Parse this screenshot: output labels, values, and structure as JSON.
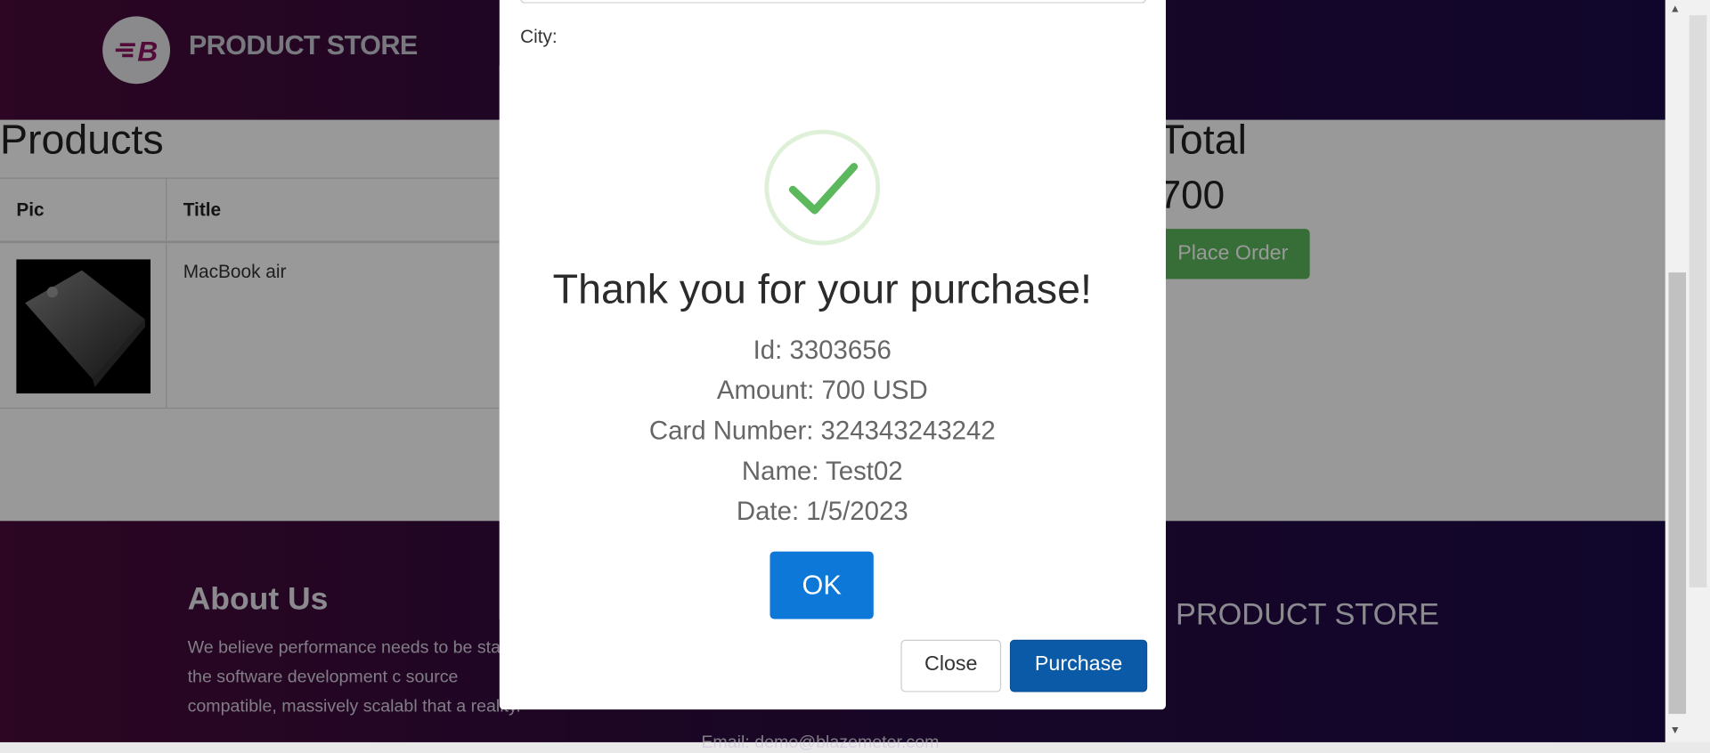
{
  "header": {
    "brand": "PRODUCT STORE"
  },
  "cart": {
    "products_title": "Products",
    "columns": {
      "pic": "Pic",
      "title": "Title"
    },
    "rows": [
      {
        "title": "MacBook air"
      }
    ],
    "total_title": "Total",
    "total_value": "700",
    "place_order": "Place Order"
  },
  "footer": {
    "about_title": "About Us",
    "about_text": "We believe performance needs to be stage of the software development c source compatible, massively scalabl that a reality.",
    "brand": "PRODUCT STORE",
    "email": "Email: demo@blazemeter.com"
  },
  "order_modal": {
    "city_label": "City:",
    "close": "Close",
    "purchase": "Purchase"
  },
  "alert": {
    "title": "Thank you for your purchase!",
    "id_line": "Id: 3303656",
    "amount_line": "Amount: 700 USD",
    "card_line": "Card Number: 324343243242",
    "name_line": "Name: Test02",
    "date_line": "Date: 1/5/2023",
    "ok": "OK",
    "icon": "checkmark-icon",
    "accent": "#5cb85c"
  }
}
